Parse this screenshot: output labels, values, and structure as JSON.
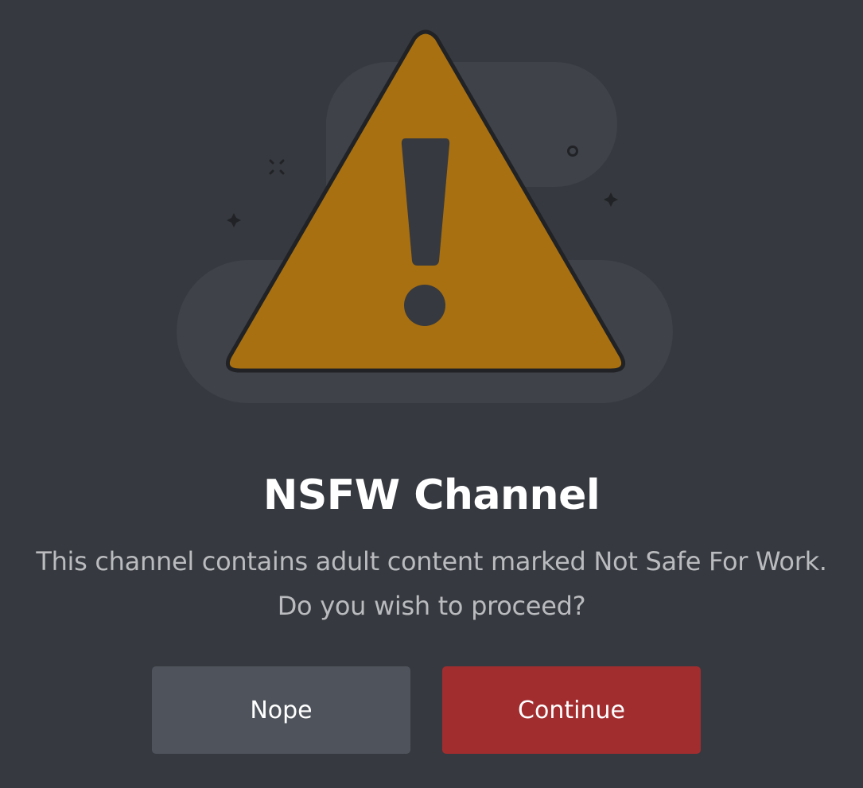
{
  "dialog": {
    "title": "NSFW Channel",
    "description_line1": "This channel contains adult content marked Not Safe For Work.",
    "description_line2": "Do you wish to proceed?",
    "decline_label": "Nope",
    "confirm_label": "Continue"
  },
  "illustration": {
    "icon": "warning-triangle-icon",
    "sparkles": [
      "cross-sparkle-icon",
      "plus-sparkle-icon",
      "plus-sparkle-icon",
      "ring-sparkle-icon"
    ]
  },
  "colors": {
    "background": "#36393f",
    "backdrop_shape": "#3f4249",
    "warning_fill": "#a87010",
    "outline": "#202225",
    "title": "#ffffff",
    "description": "#b9bbbe",
    "secondary_button": "#4f545c",
    "danger_button": "#a12d2f"
  }
}
